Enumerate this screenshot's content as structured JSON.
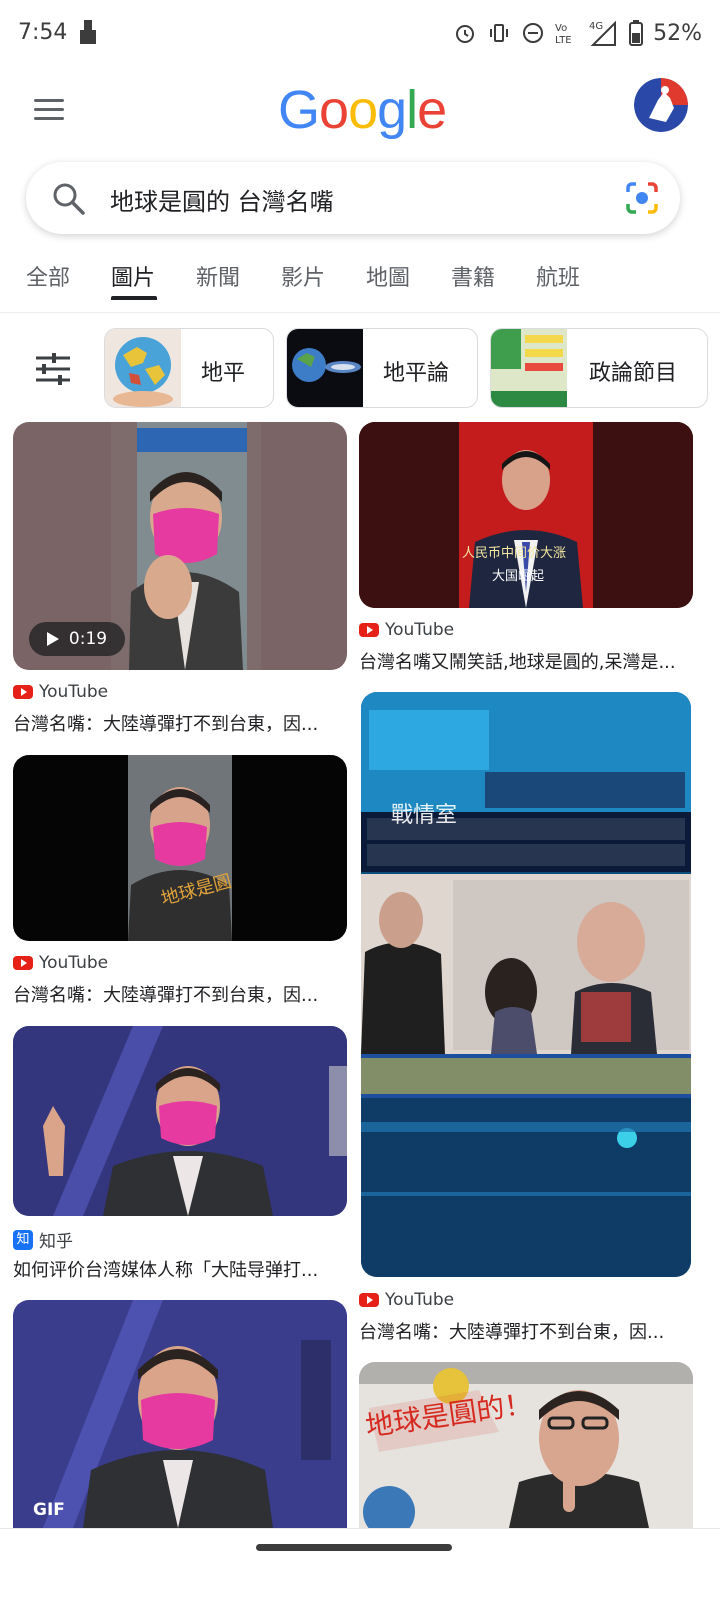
{
  "status_bar": {
    "time": "7:54",
    "battery": "52%"
  },
  "header": {
    "logo_text": "Google"
  },
  "search": {
    "query": "地球是圓的 台灣名嘴"
  },
  "tabs": [
    "全部",
    "圖片",
    "新聞",
    "影片",
    "地圖",
    "書籍",
    "航班"
  ],
  "active_tab": "圖片",
  "chips": [
    "地平",
    "地平論",
    "政論節目"
  ],
  "results_left": [
    {
      "source": "YouTube",
      "title": "台灣名嘴：大陸導彈打不到台東，因...",
      "duration": "0:19"
    },
    {
      "source": "YouTube",
      "title": "台灣名嘴：大陸導彈打不到台東，因..."
    },
    {
      "source": "知乎",
      "source_icon": "知",
      "title": "如何评价台湾媒体人称「大陆导弹打..."
    },
    {
      "badge": "GIF"
    }
  ],
  "results_right": [
    {
      "source": "YouTube",
      "title": "台灣名嘴又鬧笑話,地球是圓的,呆灣是..."
    },
    {
      "source": "YouTube",
      "title": "台灣名嘴：大陸導彈打不到台東，因..."
    }
  ],
  "colors": {
    "youtube_red": "#e62117",
    "zhihu_blue": "#1772f6",
    "mask_pink": "#e63aa0"
  }
}
